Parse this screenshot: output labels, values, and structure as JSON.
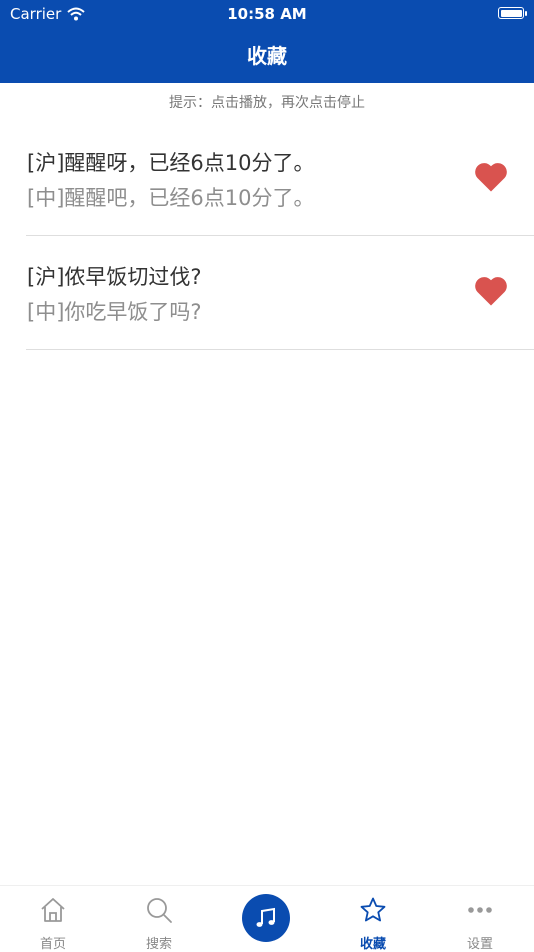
{
  "status_bar": {
    "carrier": "Carrier",
    "time": "10:58 AM"
  },
  "nav": {
    "title": "收藏"
  },
  "hint": "提示：点击播放，再次点击停止",
  "favorites": [
    {
      "sh": "[沪]醒醒呀，已经6点10分了。",
      "zh": "[中]醒醒吧，已经6点10分了。"
    },
    {
      "sh": "[沪]侬早饭切过伐?",
      "zh": "[中]你吃早饭了吗?"
    }
  ],
  "tabs": {
    "home": "首页",
    "search": "搜索",
    "favorites": "收藏",
    "settings": "设置"
  },
  "colors": {
    "brand": "#0a4cb0",
    "heart": "#d9534f"
  }
}
